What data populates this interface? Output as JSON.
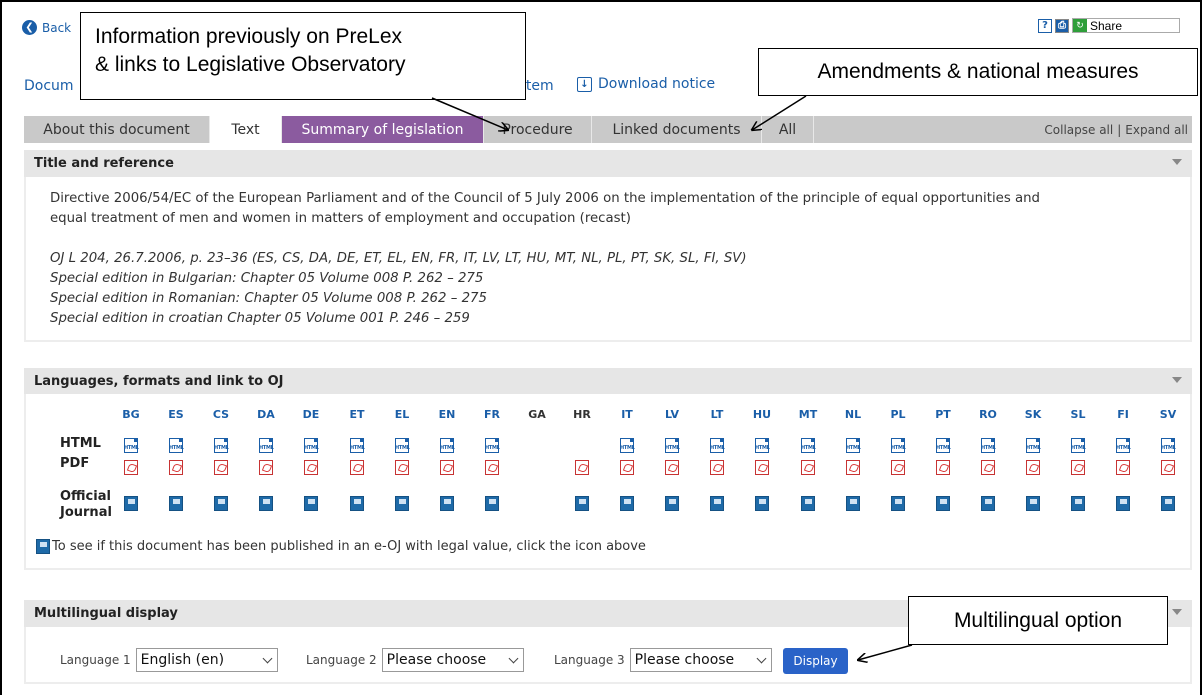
{
  "nav": {
    "back_label": "Back",
    "document_link": "Docum",
    "item_link": "item",
    "download_notice": "Download notice",
    "share_label": "Share",
    "icons": [
      "help-icon",
      "print-icon",
      "share-icon"
    ]
  },
  "tabs": [
    {
      "label": "About this document"
    },
    {
      "label": "Text"
    },
    {
      "label": "Summary of legislation"
    },
    {
      "label": "Procedure"
    },
    {
      "label": "Linked documents"
    },
    {
      "label": "All"
    }
  ],
  "collapse_all": "Collapse all",
  "expand_all": "Expand all",
  "divider": "|",
  "title_panel": {
    "heading": "Title and reference",
    "title_line1": "Directive 2006/54/EC of the European Parliament and of the Council of 5 July 2006 on the implementation of the principle of equal opportunities and",
    "title_line2": "equal treatment of men and women in matters of employment and occupation (recast)",
    "refs": [
      "OJ L 204, 26.7.2006, p. 23–36 (ES, CS, DA, DE, ET, EL, EN, FR, IT, LV, LT, HU, MT, NL, PL, PT, SK, SL, FI, SV)",
      "Special edition in Bulgarian: Chapter 05 Volume 008 P. 262 – 275",
      "Special edition in Romanian: Chapter 05 Volume 008 P. 262 – 275",
      "Special edition in croatian Chapter 05 Volume 001 P. 246 – 259"
    ]
  },
  "languages_panel": {
    "heading": "Languages, formats and link to OJ",
    "languages": [
      "BG",
      "ES",
      "CS",
      "DA",
      "DE",
      "ET",
      "EL",
      "EN",
      "FR",
      "GA",
      "HR",
      "IT",
      "LV",
      "LT",
      "HU",
      "MT",
      "NL",
      "PL",
      "PT",
      "RO",
      "SK",
      "SL",
      "FI",
      "SV"
    ],
    "row_html": "HTML",
    "row_pdf": "PDF",
    "row_oj1": "Official",
    "row_oj2": "Journal",
    "oj_note": "To see if this document has been published in an e-OJ with legal value, click the icon above"
  },
  "multilingual_panel": {
    "heading": "Multilingual display",
    "language1_label": "Language 1",
    "language1_value": "English (en)",
    "language2_label": "Language 2",
    "language2_value": "Please choose",
    "language3_label": "Language 3",
    "language3_value": "Please choose",
    "display_button": "Display"
  },
  "callouts": {
    "prelex_line1": "Information previously on PreLex",
    "prelex_line2": "& links to Legislative Observatory",
    "amendments": "Amendments & national measures",
    "multilingual": "Multilingual option"
  },
  "colors": {
    "link_blue": "#1a5ea8",
    "summary_tab": "#8b5b9f",
    "tab_bar": "#c9c9c9",
    "panel_header": "#e6e6e6",
    "display_button": "#2a63c8"
  }
}
